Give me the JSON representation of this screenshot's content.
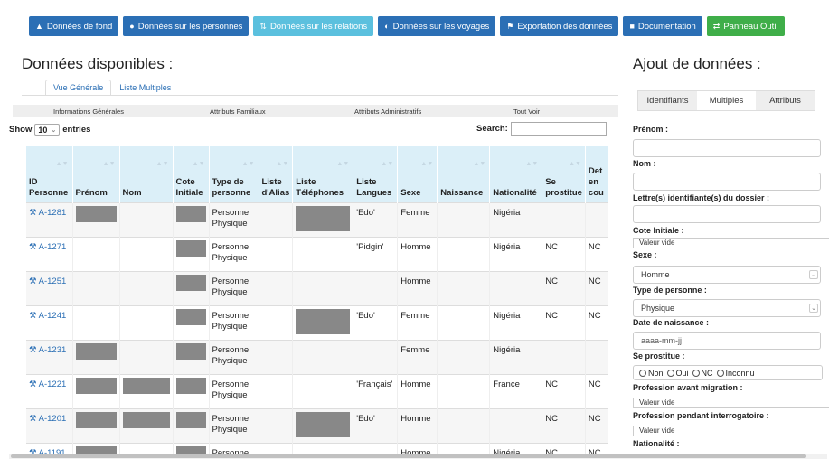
{
  "nav": [
    {
      "label": "Données de fond",
      "icon": "bell-icon",
      "style": "blue"
    },
    {
      "label": "Données sur les personnes",
      "icon": "user-icon",
      "style": "blue"
    },
    {
      "label": "Données sur les relations",
      "icon": "arrows-icon",
      "style": "light"
    },
    {
      "label": "Données sur les voyages",
      "icon": "globe-icon",
      "style": "blue"
    },
    {
      "label": "Exportation des données",
      "icon": "flag-icon",
      "style": "blue"
    },
    {
      "label": "Documentation",
      "icon": "book-icon",
      "style": "blue"
    },
    {
      "label": "Panneau Outil",
      "icon": "swap-icon",
      "style": "green"
    }
  ],
  "left": {
    "title": "Données disponibles :",
    "tabs": [
      "Vue Générale",
      "Liste Multiples"
    ],
    "subbar": [
      "Informations Générales",
      "Attributs Familiaux",
      "Attributs Administratifs",
      "Tout Voir"
    ],
    "show_prefix": "Show",
    "show_value": "10",
    "show_suffix": "entries",
    "search_label": "Search:"
  },
  "table": {
    "columns": [
      "ID Personne",
      "Prénom",
      "Nom",
      "Cote Initiale",
      "Type de personne",
      "Liste d'Alias",
      "Liste Téléphones",
      "Liste Langues",
      "Sexe",
      "Naissance",
      "Nationalité",
      "Se prostitue",
      "Det en cou"
    ],
    "rows": [
      {
        "id": "A-1281",
        "prenom": true,
        "nom": false,
        "cote": true,
        "type": "Personne Physique",
        "tel": true,
        "langues": "'Edo'",
        "sexe": "Femme",
        "nat": "Nigéria",
        "prost": "",
        "det": ""
      },
      {
        "id": "A-1271",
        "prenom": false,
        "nom": false,
        "cote": true,
        "type": "Personne Physique",
        "tel": false,
        "langues": "'Pidgin'",
        "sexe": "Homme",
        "nat": "Nigéria",
        "prost": "NC",
        "det": "NC"
      },
      {
        "id": "A-1251",
        "prenom": false,
        "nom": false,
        "cote": true,
        "type": "Personne Physique",
        "tel": false,
        "langues": "",
        "sexe": "Homme",
        "nat": "",
        "prost": "NC",
        "det": "NC"
      },
      {
        "id": "A-1241",
        "prenom": false,
        "nom": false,
        "cote": true,
        "type": "Personne Physique",
        "tel": true,
        "langues": "'Edo'",
        "sexe": "Femme",
        "nat": "Nigéria",
        "prost": "NC",
        "det": "NC"
      },
      {
        "id": "A-1231",
        "prenom": true,
        "nom": false,
        "cote": true,
        "type": "Personne Physique",
        "tel": false,
        "langues": "",
        "sexe": "Femme",
        "nat": "Nigéria",
        "prost": "",
        "det": ""
      },
      {
        "id": "A-1221",
        "prenom": true,
        "nom": true,
        "cote": true,
        "type": "Personne Physique",
        "tel": false,
        "langues": "'Français'",
        "sexe": "Homme",
        "nat": "France",
        "prost": "NC",
        "det": "NC"
      },
      {
        "id": "A-1201",
        "prenom": true,
        "nom": true,
        "cote": true,
        "type": "Personne Physique",
        "tel": true,
        "langues": "'Edo'",
        "sexe": "Homme",
        "nat": "",
        "prost": "NC",
        "det": "NC"
      },
      {
        "id": "A-1191",
        "prenom": true,
        "nom": false,
        "cote": true,
        "type": "Personne",
        "tel": false,
        "langues": "",
        "sexe": "Homme",
        "nat": "Nigéria",
        "prost": "NC",
        "det": "NC"
      }
    ]
  },
  "right": {
    "title": "Ajout de données :",
    "tabs": [
      "Identifiants",
      "Multiples",
      "Attributs"
    ],
    "prenom_label": "Prénom :",
    "nom_label": "Nom :",
    "lettres_label": "Lettre(s) identifiante(s) du dossier :",
    "cote_label": "Cote Initiale :",
    "cote_value": "Valeur vide",
    "sexe_label": "Sexe :",
    "sexe_value": "Homme",
    "type_label": "Type de personne :",
    "type_value": "Physique",
    "naissance_label": "Date de naissance :",
    "naissance_placeholder": "aaaa-mm-jj",
    "prostitue_label": "Se prostitue :",
    "prostitue_options": [
      "Non",
      "Oui",
      "NC",
      "Inconnu"
    ],
    "prof_avant_label": "Profession avant migration :",
    "prof_avant_value": "Valeur vide",
    "prof_pendant_label": "Profession pendant interrogatoire :",
    "prof_pendant_value": "Valeur vide",
    "nationalite_label": "Nationalité :"
  }
}
